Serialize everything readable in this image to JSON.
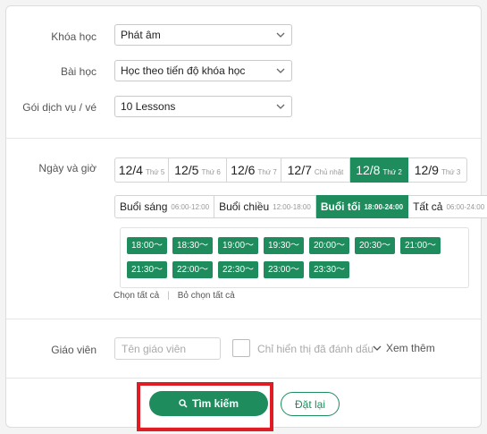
{
  "filters": {
    "course": {
      "label": "Khóa học",
      "value": "Phát âm"
    },
    "lesson": {
      "label": "Bài học",
      "value": "Học theo tiến độ khóa học"
    },
    "package": {
      "label": "Gói dịch vụ / vé",
      "value": "10 Lessons"
    }
  },
  "schedule": {
    "label": "Ngày và giờ",
    "dates": [
      {
        "date": "12/4",
        "weekday": "Thứ 5",
        "active": false
      },
      {
        "date": "12/5",
        "weekday": "Thứ 6",
        "active": false
      },
      {
        "date": "12/6",
        "weekday": "Thứ 7",
        "active": false
      },
      {
        "date": "12/7",
        "weekday": "Chủ nhật",
        "active": false
      },
      {
        "date": "12/8",
        "weekday": "Thứ 2",
        "active": true
      },
      {
        "date": "12/9",
        "weekday": "Thứ 3",
        "active": false
      }
    ],
    "sessions": [
      {
        "name": "Buổi sáng",
        "time": "06:00-12:00",
        "active": false
      },
      {
        "name": "Buổi chiều",
        "time": "12:00-18:00",
        "active": false
      },
      {
        "name": "Buổi tối",
        "time": "18:00-24:00",
        "active": true
      },
      {
        "name": "Tất cả",
        "time": "06:00-24:00",
        "active": false
      }
    ],
    "slots": [
      "18:00〜",
      "18:30〜",
      "19:00〜",
      "19:30〜",
      "20:00〜",
      "20:30〜",
      "21:00〜",
      "21:30〜",
      "22:00〜",
      "22:30〜",
      "23:00〜",
      "23:30〜"
    ],
    "select_all": "Chọn tất cả",
    "deselect_all": "Bỏ chọn tất cả"
  },
  "teacher": {
    "label": "Giáo viên",
    "placeholder": "Tên giáo viên",
    "bookmark_only": "Chỉ hiển thị đã đánh dấu",
    "see_more": "Xem thêm"
  },
  "actions": {
    "search": "Tìm kiếm",
    "reset": "Đặt lại"
  },
  "colors": {
    "accent": "#1e8c5d",
    "highlight": "#e01b24"
  }
}
